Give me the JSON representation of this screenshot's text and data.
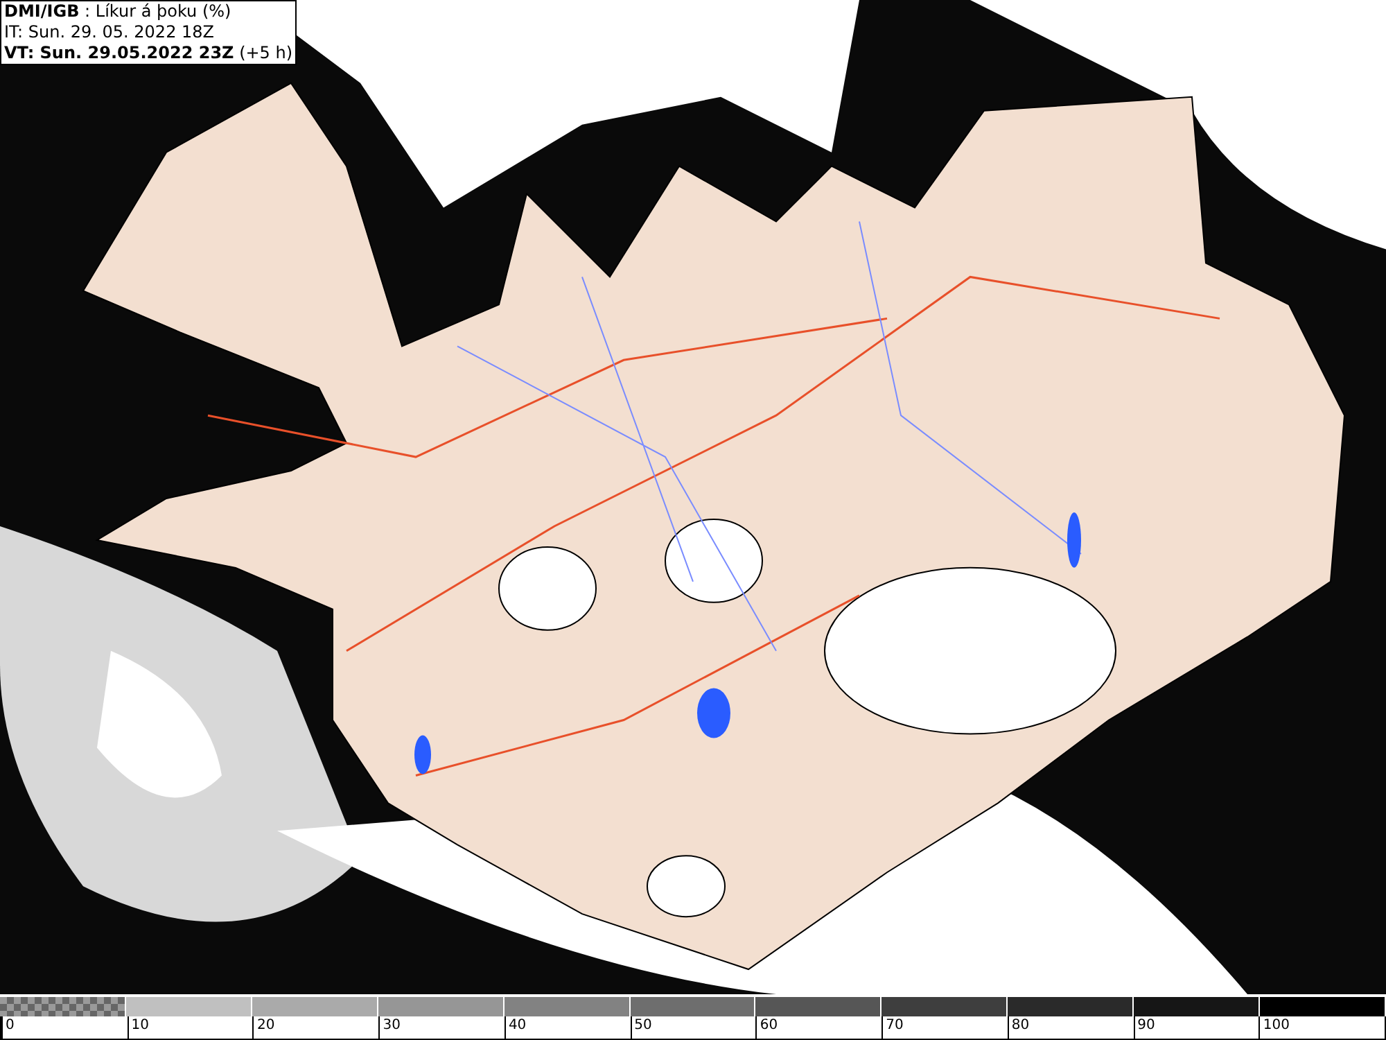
{
  "title_box": {
    "lines": [
      "**DMI/IGB** : Líkur á þoku (%)",
      "IT: Sun. 29. 05. 2022 18Z",
      "**VT: Sun. 29.05.2022 23Z** (+5 h)"
    ]
  },
  "legend": {
    "bins": [
      {
        "kind": "checker",
        "color": "#9a9a9a"
      },
      {
        "kind": "solid",
        "color": "#c0c0c0"
      },
      {
        "kind": "solid",
        "color": "#aaaaaa"
      },
      {
        "kind": "solid",
        "color": "#969696"
      },
      {
        "kind": "solid",
        "color": "#828282"
      },
      {
        "kind": "solid",
        "color": "#6e6e6e"
      },
      {
        "kind": "solid",
        "color": "#565656"
      },
      {
        "kind": "solid",
        "color": "#3e3e3e"
      },
      {
        "kind": "solid",
        "color": "#2a2a2a"
      },
      {
        "kind": "solid",
        "color": "#161616"
      },
      {
        "kind": "solid",
        "color": "#000000"
      }
    ],
    "labels": [
      "0",
      "10",
      "20",
      "30",
      "40",
      "50",
      "60",
      "70",
      "80",
      "90",
      "100"
    ]
  }
}
